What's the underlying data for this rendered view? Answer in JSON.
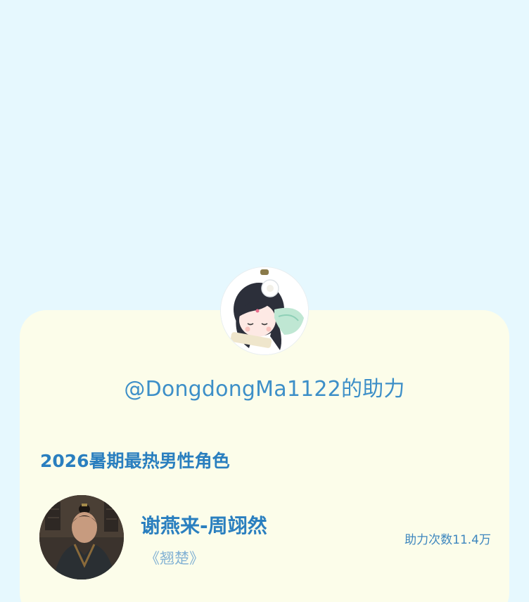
{
  "card": {
    "helper_name": "@DongdongMa1122",
    "helper_suffix": "的助力",
    "section_title": "2026暑期最热男性角色"
  },
  "character": {
    "name": "谢燕来-周翊然",
    "work": "《翘楚》",
    "support_label": "助力次数",
    "support_count": "11.4万"
  },
  "icons": {
    "user_avatar": "chibi-girl-avatar",
    "character_avatar": "character-photo-avatar"
  }
}
